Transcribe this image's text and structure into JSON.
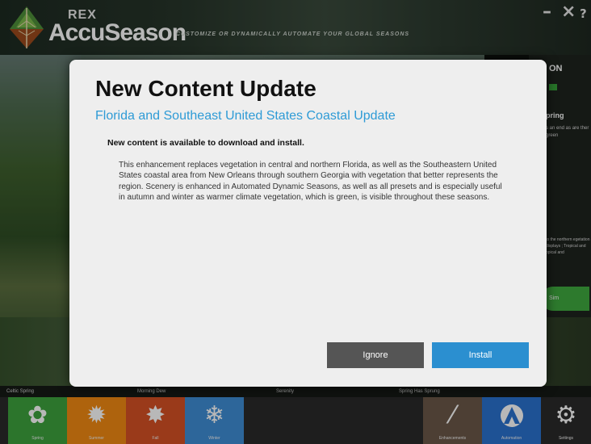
{
  "app": {
    "brand_small": "REX",
    "brand_name": "AccuSeason",
    "tagline": "CUSTOMIZE OR DYNAMICALLY AUTOMATE YOUR GLOBAL SEASONS",
    "window_controls": [
      "–",
      "×",
      "?"
    ]
  },
  "background": {
    "right_panel": {
      "title": "ON",
      "heading": "pring",
      "text": "s an end as are ther green",
      "text2": "to the northern egetation displays ; Tropical and opical and",
      "button_label": "Sim"
    },
    "thumbnails": [
      "Celtic Spring",
      "Morning Dew",
      "Serenity",
      "Spring Has Sprung"
    ]
  },
  "nav": {
    "items": [
      {
        "label": "Spring",
        "color": "#3ea33e",
        "icon": "gear-flower-icon"
      },
      {
        "label": "Summer",
        "color": "#f28a12",
        "icon": "sun-icon"
      },
      {
        "label": "Fall",
        "color": "#d65124",
        "icon": "maple-leaf-icon"
      },
      {
        "label": "Winter",
        "color": "#3f8ed6",
        "icon": "snowflake-icon"
      },
      {
        "label": "Enhancements",
        "color": "#6b5849",
        "icon": "magic-wand-icon"
      },
      {
        "label": "Automation",
        "color": "#2a72cf",
        "icon": "automation-a-icon"
      },
      {
        "label": "Settings",
        "color": "#2a2a2a",
        "icon": "gear-icon"
      }
    ]
  },
  "dialog": {
    "title": "New Content Update",
    "subtitle": "Florida and Southeast United States Coastal Update",
    "lead": "New content is available to download and install.",
    "body": "This enhancement replaces vegetation in central and northern Florida, as well as the Southeastern United States coastal area from New Orleans through southern Georgia with vegetation that better represents the region. Scenery is enhanced in Automated Dynamic Seasons, as well as all presets and is especially useful in autumn and winter as warmer climate vegetation, which is green, is visible throughout these seasons.",
    "ignore_label": "Ignore",
    "install_label": "Install"
  }
}
